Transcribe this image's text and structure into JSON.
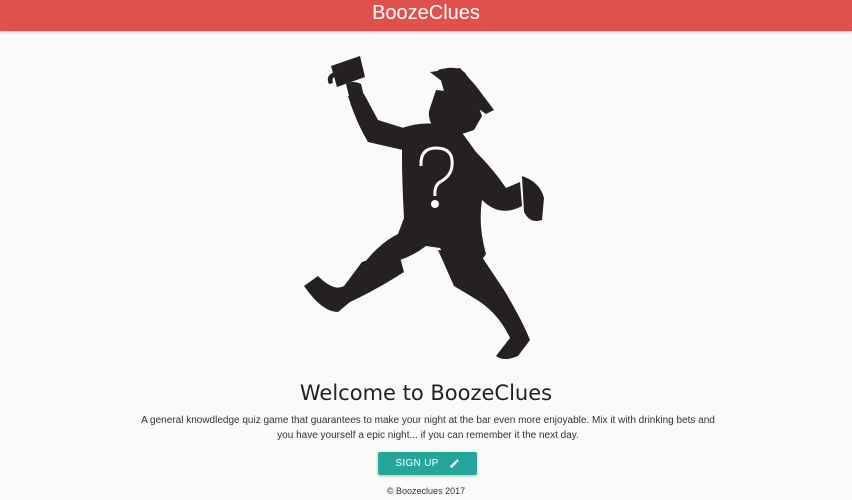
{
  "navbar": {
    "brand": "BoozeClues",
    "color": "#e0514d"
  },
  "hero": {
    "image_icon": "drinking-man-silhouette-question-mark"
  },
  "welcome": {
    "title": "Welcome to BoozeClues",
    "description": "A general knowdledge quiz game that guarantees to make your night at the bar even more enjoyable. Mix it with drinking bets and you have yourself a epic night... if you can remember it the next day."
  },
  "signup": {
    "label": "SIGN UP",
    "icon": "pencil-icon",
    "color": "#26a69a"
  },
  "footer": {
    "text": "© Boozeclues 2017"
  }
}
